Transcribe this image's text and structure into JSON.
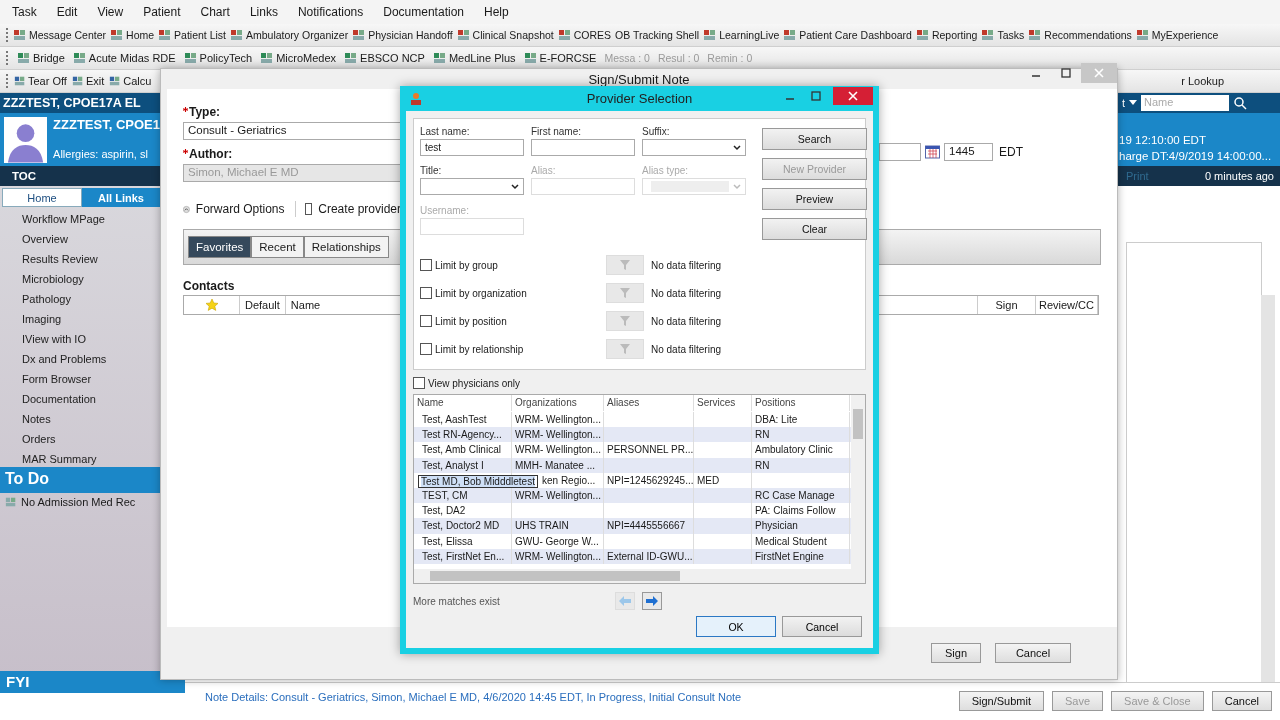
{
  "menu_bar": [
    {
      "label": "Task"
    },
    {
      "label": "Edit"
    },
    {
      "label": "View"
    },
    {
      "label": "Patient"
    },
    {
      "label": "Chart"
    },
    {
      "label": "Links"
    },
    {
      "label": "Notifications"
    },
    {
      "label": "Documentation"
    },
    {
      "label": "Help"
    }
  ],
  "toolbar_1": [
    {
      "label": "Message Center",
      "icon": true
    },
    {
      "label": "Home",
      "icon": true
    },
    {
      "label": "Patient List",
      "icon": true
    },
    {
      "label": "Ambulatory Organizer",
      "icon": true
    },
    {
      "label": "Physician Handoff",
      "icon": true
    },
    {
      "label": "Clinical Snapshot",
      "icon": true
    },
    {
      "label": "CORES",
      "icon": true
    },
    {
      "label": "OB Tracking Shell",
      "icon": false
    },
    {
      "label": "LearningLive",
      "icon": true
    },
    {
      "label": "Patient Care Dashboard",
      "icon": true
    },
    {
      "label": "Reporting",
      "icon": true
    },
    {
      "label": "Tasks",
      "icon": true
    },
    {
      "label": "Recommendations",
      "icon": true
    },
    {
      "label": "MyExperience",
      "icon": true
    }
  ],
  "toolbar_2": [
    {
      "label": "Bridge",
      "icon": true
    },
    {
      "label": "Acute Midas RDE",
      "icon": true
    },
    {
      "label": "PolicyTech",
      "icon": true
    },
    {
      "label": "MicroMedex",
      "icon": true
    },
    {
      "label": "EBSCO NCP",
      "icon": true
    },
    {
      "label": "MedLine Plus",
      "icon": true
    },
    {
      "label": "E-FORCSE",
      "icon": true
    }
  ],
  "counters": [
    "Messa : 0",
    "Resul : 0",
    "Remin : 0"
  ],
  "toolbar_3": [
    {
      "label": "Tear Off",
      "icon": true
    },
    {
      "label": "Exit",
      "icon": true
    },
    {
      "label": "Calcu",
      "icon": true
    }
  ],
  "toolbar_3_right": "r Lookup",
  "banner": {
    "name": "ZZZTEST, CPOE17A EL",
    "name_2": "ZZZTEST, CPOE1",
    "allergies": "Allergies: aspirin, sl",
    "dropdown": "t",
    "search": {
      "placeholder": "Name"
    },
    "line_1": "19 12:10:00 EDT",
    "line_2": "harge DT:4/9/2019 14:00:00...",
    "print": {
      "label": "Print",
      "disabled": true
    },
    "refresh": "0 minutes ago"
  },
  "sidebar": {
    "title": "TOC",
    "tabs": [
      {
        "label": "Home",
        "selected": true
      },
      {
        "label": "All Links",
        "selected": false
      }
    ],
    "items": [
      "Workflow MPage",
      "Overview",
      "Results Review",
      "Microbiology",
      "Pathology",
      "Imaging",
      "IView with IO",
      "Dx and Problems",
      "Form Browser",
      "Documentation",
      "Notes",
      "Orders",
      "MAR Summary"
    ],
    "todo_title": "To Do",
    "todo_items": [
      "No Admission Med Rec"
    ],
    "fyi_title": "FYI"
  },
  "sign_window": {
    "title": "Sign/Submit Note",
    "type_label": "Type:",
    "type_value": "Consult - Geriatrics",
    "author_label": "Author:",
    "author_value": "Simon, Michael E MD",
    "forward_options": "Forward Options",
    "create_provider": {
      "label": "Create provider",
      "checked": false
    },
    "time_value": "1445",
    "timezone": "EDT",
    "tabs": [
      {
        "label": "Favorites",
        "selected": true
      },
      {
        "label": "Recent",
        "selected": false
      },
      {
        "label": "Relationships",
        "selected": false
      }
    ],
    "contacts_title": "Contacts",
    "contacts_columns": [
      "Default",
      "Name",
      "Sign",
      "Review/CC"
    ],
    "buttons": [
      "Sign",
      "Cancel"
    ]
  },
  "provider_dialog": {
    "title": "Provider Selection",
    "fields": [
      {
        "label": "Last name:",
        "kind": "text",
        "value": "test",
        "disabled": false
      },
      {
        "label": "First name:",
        "kind": "text",
        "disabled": false
      },
      {
        "label": "Suffix:",
        "kind": "select",
        "disabled": false
      },
      {
        "label": "Title:",
        "kind": "select",
        "disabled": false
      },
      {
        "label": "Alias:",
        "kind": "text",
        "disabled": true
      },
      {
        "label": "Alias type:",
        "kind": "select",
        "disabled": true
      },
      {
        "label": "Username:",
        "kind": "text",
        "disabled": true
      }
    ],
    "buttons": [
      {
        "label": "Search",
        "disabled": false
      },
      {
        "label": "New Provider",
        "disabled": true
      },
      {
        "label": "Preview",
        "disabled": false
      },
      {
        "label": "Clear",
        "disabled": false
      }
    ],
    "limits": [
      {
        "label": "Limit by group",
        "checked": false,
        "filter": "No data filtering"
      },
      {
        "label": "Limit by organization",
        "checked": false,
        "filter": "No data filtering"
      },
      {
        "label": "Limit by position",
        "checked": false,
        "filter": "No data filtering"
      },
      {
        "label": "Limit by relationship",
        "checked": false,
        "filter": "No data filtering"
      }
    ],
    "view_physicians_only": {
      "label": "View physicians only",
      "checked": false
    },
    "columns": [
      "Name",
      "Organizations",
      "Aliases",
      "Services",
      "Positions"
    ],
    "rows": [
      {
        "cells": [
          "Test, AashTest",
          "WRM- Wellington...",
          "",
          "",
          "DBA: Lite"
        ],
        "editing": false
      },
      {
        "cells": [
          "Test RN-Agency...",
          "WRM- Wellington...",
          "",
          "",
          "RN"
        ],
        "editing": false
      },
      {
        "cells": [
          "Test, Amb Clinical",
          "WRM- Wellington...",
          "PERSONNEL PR...",
          "",
          "Ambulatory Clinic"
        ],
        "editing": false
      },
      {
        "cells": [
          "Test, Analyst I",
          "MMH- Manatee ...",
          "",
          "",
          "RN"
        ],
        "editing": false
      },
      {
        "cells": [
          "Test MD, Bob Midddletest",
          "ken Regio...",
          "NPI=1245629245...",
          "MED",
          ""
        ],
        "editing": true
      },
      {
        "cells": [
          "TEST, CM",
          "WRM- Wellington...",
          "",
          "",
          "RC Case Manage"
        ],
        "editing": false
      },
      {
        "cells": [
          "Test, DA2",
          "",
          "",
          "",
          "PA: Claims Follow"
        ],
        "editing": false
      },
      {
        "cells": [
          "Test, Doctor2 MD",
          "UHS TRAIN",
          "NPI=4445556667",
          "",
          "Physician"
        ],
        "editing": false
      },
      {
        "cells": [
          "Test, Elissa",
          "GWU- George W...",
          "",
          "",
          "Medical Student"
        ],
        "editing": false
      },
      {
        "cells": [
          "Test, FirstNet En...",
          "WRM- Wellington...",
          "External ID-GWU...",
          "",
          "FirstNet Engine"
        ],
        "editing": false
      }
    ],
    "status": "More matches exist",
    "prev_disabled": true,
    "next_disabled": false,
    "footer_buttons": [
      {
        "label": "OK",
        "default": true
      },
      {
        "label": "Cancel",
        "default": false
      }
    ]
  },
  "note_details": "Note Details: Consult - Geriatrics, Simon, Michael E MD, 4/6/2020 14:45 EDT, In Progress, Initial Consult Note",
  "bottom_buttons": [
    {
      "label": "Sign/Submit",
      "disabled": false
    },
    {
      "label": "Save",
      "disabled": true
    },
    {
      "label": "Save & Close",
      "disabled": true
    },
    {
      "label": "Cancel",
      "disabled": false
    }
  ]
}
